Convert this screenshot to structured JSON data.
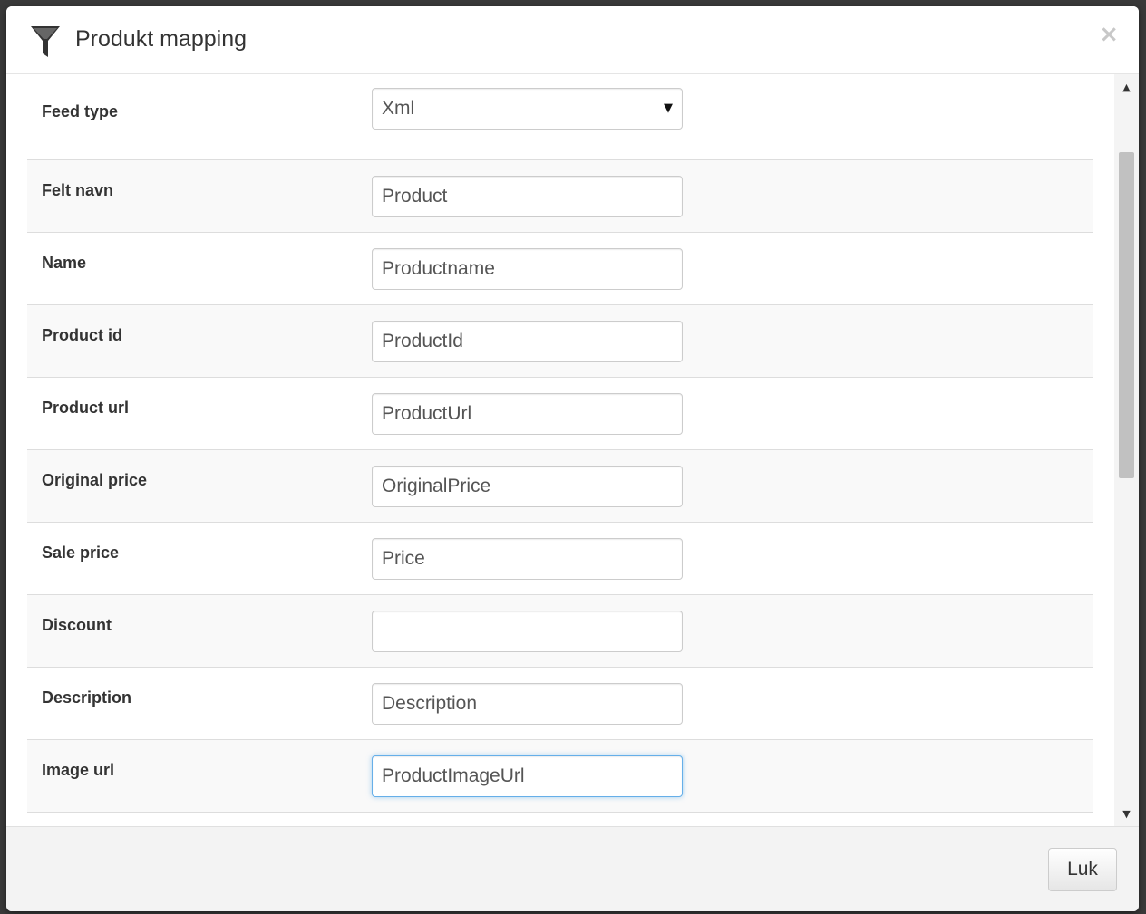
{
  "dialog": {
    "title": "Produkt mapping",
    "icon": "funnel-icon",
    "close_symbol": "×"
  },
  "form": {
    "feed_type": {
      "label": "Feed type",
      "selected": "Xml",
      "arrow": "▼"
    },
    "fields": [
      {
        "label": "Felt navn",
        "value": "Product"
      },
      {
        "label": "Name",
        "value": "Productname"
      },
      {
        "label": "Product id",
        "value": "ProductId"
      },
      {
        "label": "Product url",
        "value": "ProductUrl"
      },
      {
        "label": "Original price",
        "value": "OriginalPrice"
      },
      {
        "label": "Sale price",
        "value": "Price"
      },
      {
        "label": "Discount",
        "value": ""
      },
      {
        "label": "Description",
        "value": "Description"
      },
      {
        "label": "Image url",
        "value": "ProductImageUrl"
      }
    ]
  },
  "scrollbar": {
    "up_arrow": "▲",
    "down_arrow": "▼"
  },
  "footer": {
    "close_label": "Luk"
  },
  "colors": {
    "focus_border": "#66afe9",
    "row_alt_bg": "#f9f9f9",
    "footer_bg": "#f3f3f3"
  }
}
